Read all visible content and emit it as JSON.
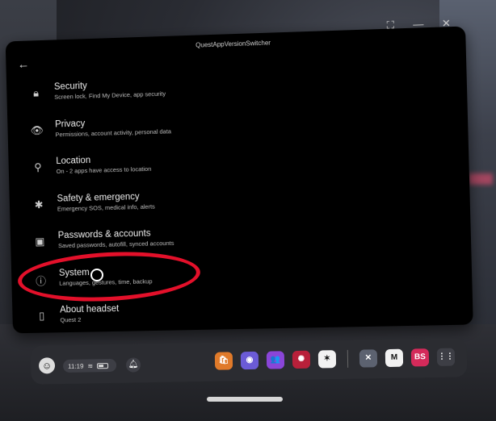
{
  "window": {
    "title": "QuestAppVersionSwitcher",
    "back_icon": "arrow-left-icon",
    "controls": [
      "expand-icon",
      "minimize-icon",
      "close-icon"
    ]
  },
  "settings": {
    "items": [
      {
        "icon": "lock-icon",
        "title": "Security",
        "subtitle": "Screen lock, Find My Device, app security"
      },
      {
        "icon": "eye-icon",
        "title": "Privacy",
        "subtitle": "Permissions, account activity, personal data"
      },
      {
        "icon": "location-pin-icon",
        "title": "Location",
        "subtitle": "On - 2 apps have access to location"
      },
      {
        "icon": "asterisk-icon",
        "title": "Safety & emergency",
        "subtitle": "Emergency SOS, medical info, alerts"
      },
      {
        "icon": "account-box-icon",
        "title": "Passwords & accounts",
        "subtitle": "Saved passwords, autofill, synced accounts"
      },
      {
        "icon": "info-icon",
        "title": "System",
        "subtitle": "Languages, gestures, time, backup"
      },
      {
        "icon": "headset-icon",
        "title": "About headset",
        "subtitle": "Quest 2"
      }
    ]
  },
  "taskbar": {
    "time": "11:19",
    "battery_level": 0.6,
    "apps": [
      {
        "name": "store",
        "color": "#e07a2a",
        "glyph": "🛍"
      },
      {
        "name": "messenger",
        "color": "#6b5bd6",
        "glyph": "◉"
      },
      {
        "name": "people",
        "color": "#8a45d8",
        "glyph": "👥"
      },
      {
        "name": "sidequest",
        "color": "#b8203a",
        "glyph": "✺"
      },
      {
        "name": "game",
        "color": "#f2f2f2",
        "glyph": "✶"
      },
      {
        "name": "explore",
        "color": "#5c6270",
        "glyph": "✕"
      },
      {
        "name": "meta-horizon",
        "color": "#f2f2f2",
        "glyph": "M"
      },
      {
        "name": "beat-saber",
        "color": "#d42a5a",
        "glyph": "BS"
      },
      {
        "name": "app-grid",
        "color": "#3d3e45",
        "glyph": "⋮⋮"
      }
    ]
  },
  "annotation": {
    "color": "#e3102a"
  }
}
